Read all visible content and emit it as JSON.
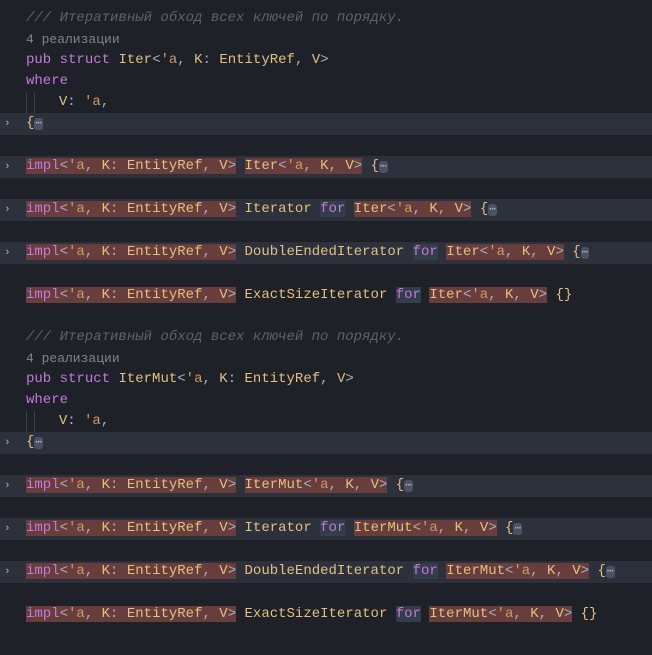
{
  "block1": {
    "comment": "/// Итеративный обход всех ключей по порядку.",
    "codelens": "4 реализации",
    "pub": "pub",
    "struct": "struct",
    "name": "Iter",
    "lt_a": "'a",
    "gen_k": "K",
    "colon": ":",
    "bound": "EntityRef",
    "gen_v": "V",
    "where": "where",
    "v_constraint_v": "V",
    "v_constraint_a": "'a"
  },
  "impl": "impl",
  "for": "for",
  "traits": {
    "iterator": "Iterator",
    "double": "DoubleEndedIterator",
    "exact": "ExactSizeIterator"
  },
  "iter": "Iter",
  "itermut": "IterMut",
  "block2": {
    "comment": "/// Итеративный обход всех ключей по порядку.",
    "codelens": "4 реализации",
    "pub": "pub",
    "struct": "struct",
    "name": "IterMut",
    "where": "where"
  },
  "g": {
    "lt_a": "'a",
    "k": "K",
    "v": "V",
    "entityref": "EntityRef"
  },
  "dots": "⋯"
}
